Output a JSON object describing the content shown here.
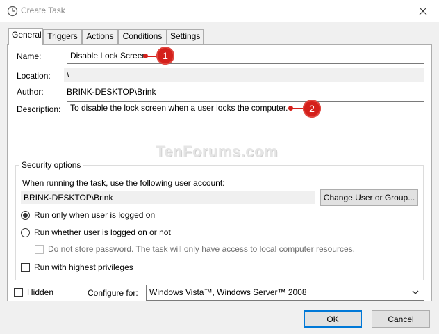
{
  "window": {
    "title": "Create Task"
  },
  "tabs": [
    {
      "label": "General",
      "active": true
    },
    {
      "label": "Triggers",
      "active": false
    },
    {
      "label": "Actions",
      "active": false
    },
    {
      "label": "Conditions",
      "active": false
    },
    {
      "label": "Settings",
      "active": false
    }
  ],
  "general": {
    "name_label": "Name:",
    "name_value": "Disable Lock Screen",
    "location_label": "Location:",
    "location_value": "\\",
    "author_label": "Author:",
    "author_value": "BRINK-DESKTOP\\Brink",
    "description_label": "Description:",
    "description_value": "To disable the lock screen when a user locks the computer."
  },
  "security": {
    "title": "Security options",
    "prompt": "When running the task, use the following user account:",
    "account": "BRINK-DESKTOP\\Brink",
    "change_button": "Change User or Group...",
    "radio_logged_on": "Run only when user is logged on",
    "radio_logged_on_checked": true,
    "radio_whether": "Run whether user is logged on or not",
    "radio_whether_checked": false,
    "no_store_password": "Do not store password.  The task will only have access to local computer resources.",
    "highest_privileges": "Run with highest privileges"
  },
  "footer": {
    "hidden_label": "Hidden",
    "configure_label": "Configure for:",
    "configure_value": "Windows Vista™, Windows Server™ 2008",
    "ok": "OK",
    "cancel": "Cancel"
  },
  "annotations": {
    "callout1": "1",
    "callout2": "2"
  },
  "watermark": "TenForums.com",
  "colors": {
    "accent": "#0078d7",
    "callout": "#d4201b"
  }
}
